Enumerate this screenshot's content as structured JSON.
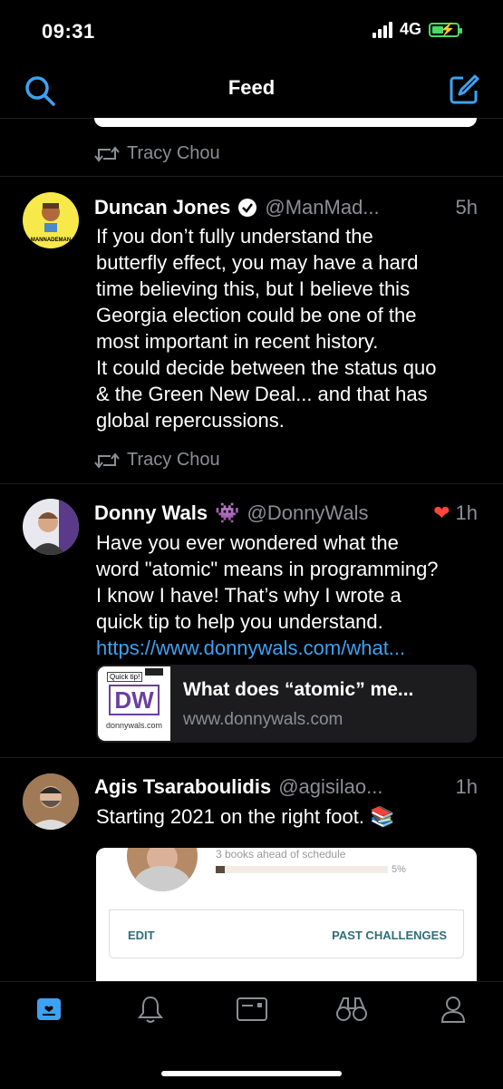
{
  "status_bar": {
    "time": "09:31",
    "network": "4G"
  },
  "header": {
    "title": "Feed"
  },
  "retweets": [
    {
      "by": "Tracy Chou"
    },
    {
      "by": "Tracy Chou"
    }
  ],
  "tweets": [
    {
      "name": "Duncan Jones",
      "handle": "@ManMad...",
      "age": "5h",
      "avatar_text": "MANNADEMAN",
      "text": "If you don’t fully understand the\nbutterfly effect, you may have a hard\ntime believing this, but I believe this\nGeorgia election could be one of the\nmost important in recent history.\nIt could decide between the status quo\n& the Green New Deal... and that has\nglobal repercussions."
    },
    {
      "name": "Donny Wals",
      "emoji": "👾",
      "handle": "@DonnyWals",
      "age": "1h",
      "liked": true,
      "text": "Have you ever wondered what the\nword \"atomic\" means in programming?\nI know I have! That’s why I wrote a\nquick tip to help you understand.",
      "link": "https://www.donnywals.com/what...",
      "card": {
        "thumb_label": "Quick tip!",
        "thumb_logo": "DW",
        "thumb_site": "donnywals.com",
        "title": "What does “atomic” me...",
        "url": "www.donnywals.com"
      }
    },
    {
      "name": "Agis Tsaraboulidis",
      "handle": "@agisilao...",
      "age": "1h",
      "text": "Starting 2021 on the right foot. 📚",
      "embed": {
        "subtitle": "3 books ahead of schedule",
        "progress_percent": 5,
        "progress_label": "5%",
        "edit_label": "EDIT",
        "past_label": "PAST CHALLENGES"
      }
    }
  ],
  "tabbar": {
    "items": [
      {
        "name": "feed",
        "icon": "feed-icon",
        "active": true
      },
      {
        "name": "notifications",
        "icon": "bell-icon"
      },
      {
        "name": "messages",
        "icon": "inbox-icon"
      },
      {
        "name": "explore",
        "icon": "binoculars-icon"
      },
      {
        "name": "profile",
        "icon": "person-icon"
      }
    ]
  },
  "colors": {
    "accent": "#3da2f2",
    "muted": "#8a8f95",
    "like": "#ff453a",
    "battery": "#4cd964"
  }
}
